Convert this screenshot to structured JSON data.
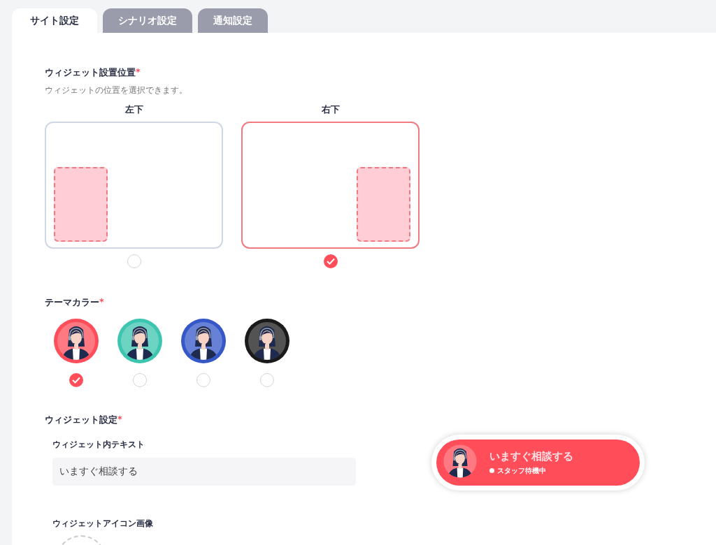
{
  "tabs": [
    {
      "label": "サイト設定",
      "selected": true
    },
    {
      "label": "シナリオ設定",
      "selected": false
    },
    {
      "label": "通知設定",
      "selected": false
    }
  ],
  "position": {
    "title": "ウィジェット設置位置",
    "required_mark": "*",
    "description": "ウィジェットの位置を選択できます。",
    "options": [
      {
        "label": "左下",
        "kind": "left",
        "selected": false
      },
      {
        "label": "右下",
        "kind": "right",
        "selected": true
      }
    ]
  },
  "theme": {
    "title": "テーマカラー",
    "required_mark": "*",
    "options": [
      {
        "color": "#ff4d5a",
        "selected": true
      },
      {
        "color": "#3cc6b0",
        "selected": false
      },
      {
        "color": "#3557c8",
        "selected": false
      },
      {
        "color": "#1a1a1a",
        "selected": false
      }
    ]
  },
  "widget": {
    "title": "ウィジェット設定",
    "required_mark": "*",
    "text_label": "ウィジェット内テキスト",
    "text_value": "いますぐ相談する",
    "icon_label": "ウィジェットアイコン画像",
    "preview": {
      "title": "いますぐ相談する",
      "status": "スタッフ待機中"
    }
  }
}
